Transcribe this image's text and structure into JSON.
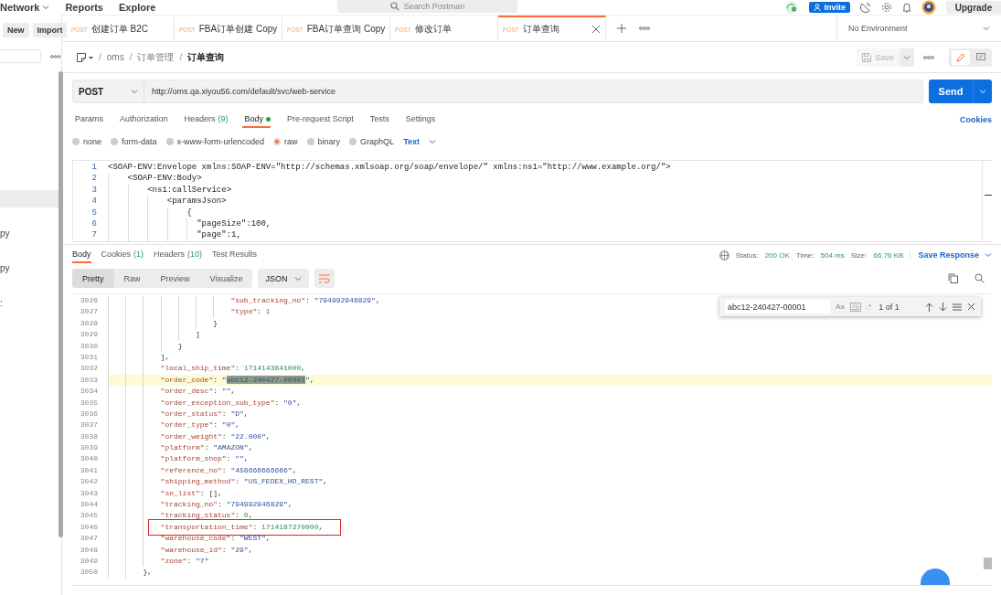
{
  "top_bar": {
    "menus": [
      {
        "label": "Network",
        "dropdown": true
      },
      {
        "label": "Reports",
        "dropdown": false
      },
      {
        "label": "Explore",
        "dropdown": false
      }
    ],
    "search": {
      "placeholder": "Search Postman"
    },
    "invite_button": "Invite",
    "upgrade_button": "Upgrade"
  },
  "sidebar": {
    "buttons": [
      "New",
      "Import"
    ],
    "rows": [
      {
        "selected": true
      },
      {
        "label": "py",
        "selected": false
      },
      {
        "label": "py",
        "selected": false
      },
      {
        "label": ":",
        "selected": false
      }
    ]
  },
  "tabs": [
    {
      "method": "POST",
      "label": "创建订单 B2C",
      "selected": false
    },
    {
      "method": "POST",
      "label": "FBA订单创建 Copy",
      "selected": false
    },
    {
      "method": "POST",
      "label": "FBA订单查询 Copy",
      "selected": false
    },
    {
      "method": "POST",
      "label": "修改订单",
      "selected": false
    },
    {
      "method": "POST",
      "label": "订单查询",
      "selected": true
    }
  ],
  "environment": "No Environment",
  "breadcrumb": [
    {
      "separator": "/",
      "label": "oms"
    },
    {
      "separator": "/",
      "label": "订单管理"
    },
    {
      "separator": "/",
      "label": "订单查询"
    }
  ],
  "save_button": "Save",
  "request": {
    "method": "POST",
    "url": "http://oms.qa.xiyou56.com/default/svc/web-service",
    "send_button": "Send",
    "tabs": [
      {
        "label": "Params",
        "selected": false
      },
      {
        "label": "Authorization",
        "selected": false
      },
      {
        "label": "Headers",
        "count": "(9)",
        "selected": false
      },
      {
        "label": "Body",
        "has_content": true,
        "selected": true
      },
      {
        "label": "Pre-request Script",
        "selected": false
      },
      {
        "label": "Tests",
        "selected": false
      },
      {
        "label": "Settings",
        "selected": false
      }
    ],
    "cookies_link": "Cookies",
    "body_types": [
      {
        "label": "none",
        "selected": false
      },
      {
        "label": "form-data",
        "selected": false
      },
      {
        "label": "x-www-form-urlencoded",
        "selected": false
      },
      {
        "label": "raw",
        "selected": true
      },
      {
        "label": "binary",
        "selected": false
      },
      {
        "label": "GraphQL",
        "selected": false
      }
    ],
    "body_format": "Text",
    "lines": [
      {
        "num": "1",
        "text": "<SOAP-ENV:Envelope xmlns:SOAP-ENV=\"http://schemas.xmlsoap.org/soap/envelope/\" xmlns:ns1=\"http://www.example.org/\">"
      },
      {
        "num": "2",
        "text": "    <SOAP-ENV:Body>"
      },
      {
        "num": "3",
        "text": "        <ns1:callService>"
      },
      {
        "num": "4",
        "text": "            <paramsJson>"
      },
      {
        "num": "5",
        "text": "                {"
      },
      {
        "num": "6",
        "text": "                  \"pageSize\":100,"
      },
      {
        "num": "7",
        "text": "                  \"page\":1,"
      }
    ]
  },
  "response": {
    "tabs": [
      {
        "label": "Body",
        "selected": true
      },
      {
        "label": "Cookies",
        "count": "(1)",
        "selected": false
      },
      {
        "label": "Headers",
        "count": "(10)",
        "selected": false
      },
      {
        "label": "Test Results",
        "selected": false
      }
    ],
    "status_label": "Status:",
    "status": "200 OK",
    "time_label": "Time:",
    "time": "504 ms",
    "size_label": "Size:",
    "size": "66.76 KB",
    "save_response": "Save Response",
    "views": [
      {
        "label": "Pretty",
        "selected": true
      },
      {
        "label": "Raw",
        "selected": false
      },
      {
        "label": "Preview",
        "selected": false
      },
      {
        "label": "Visualize",
        "selected": false
      }
    ],
    "format": "JSON",
    "find": {
      "value": "abc12-240427-00001",
      "options": [
        "Aa",
        ".*"
      ],
      "count": "1 of 1"
    },
    "lines": [
      {
        "num": "3026",
        "text": "                            \"sub_tracking_no\": \"794992946829\","
      },
      {
        "num": "3027",
        "text": "                            \"type\": 1"
      },
      {
        "num": "3028",
        "text": "                        }"
      },
      {
        "num": "3029",
        "text": "                    ]"
      },
      {
        "num": "3030",
        "text": "                }"
      },
      {
        "num": "3031",
        "text": "            ],"
      },
      {
        "num": "3032",
        "text": "            \"local_ship_time\": 1714143841000,"
      },
      {
        "num": "3033",
        "text": "            \"order_code\": \"abc12-240427-00001\",",
        "highlighted": true,
        "match_selected": true
      },
      {
        "num": "3034",
        "text": "            \"order_desc\": \"\","
      },
      {
        "num": "3035",
        "text": "            \"order_exception_sub_type\": \"0\","
      },
      {
        "num": "3036",
        "text": "            \"order_status\": \"D\","
      },
      {
        "num": "3037",
        "text": "            \"order_type\": \"0\","
      },
      {
        "num": "3038",
        "text": "            \"order_weight\": \"22.000\","
      },
      {
        "num": "3039",
        "text": "            \"platform\": \"AMAZON\","
      },
      {
        "num": "3040",
        "text": "            \"platform_shop\": \"\","
      },
      {
        "num": "3041",
        "text": "            \"reference_no\": \"456666666666\","
      },
      {
        "num": "3042",
        "text": "            \"shipping_method\": \"US_FEDEX_HD_REST\","
      },
      {
        "num": "3043",
        "text": "            \"sn_list\": [],"
      },
      {
        "num": "3044",
        "text": "            \"tracking_no\": \"794992946829\","
      },
      {
        "num": "3045",
        "text": "            \"tracking_status\": 0,"
      },
      {
        "num": "3046",
        "text": "            \"transportation_time\": 1714187270000,",
        "annotated": true
      },
      {
        "num": "3047",
        "text": "            \"warehouse_code\": \"WEST\","
      },
      {
        "num": "3048",
        "text": "            \"warehouse_id\": \"29\","
      },
      {
        "num": "3049",
        "text": "            \"zone\": \"7\""
      },
      {
        "num": "3050",
        "text": "        },"
      }
    ]
  }
}
